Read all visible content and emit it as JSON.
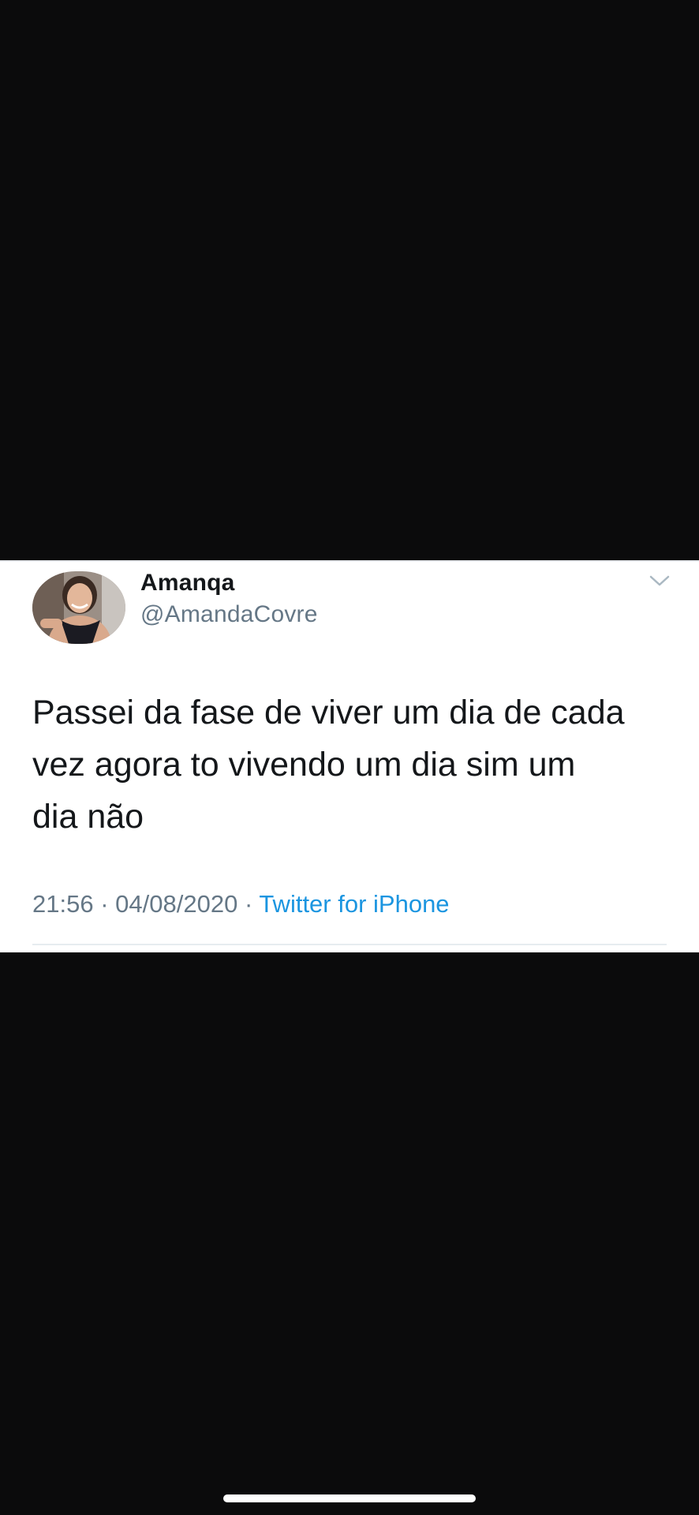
{
  "tweet": {
    "display_name": "Amanqa",
    "handle": "@AmandaCovre",
    "text_lines": [
      "Passei da fase de viver um dia de cada",
      "vez agora to vivendo um dia sim um",
      "dia não"
    ],
    "time": "21:56",
    "separator": "·",
    "date": "04/08/2020",
    "source": "Twitter for iPhone"
  },
  "icons": {
    "avatar": "profile-photo",
    "menu": "chevron-down-icon"
  },
  "colors": {
    "background": "#0b0b0c",
    "card": "#ffffff",
    "name_text": "#14171a",
    "secondary_text": "#657786",
    "link": "#1b95e0"
  }
}
